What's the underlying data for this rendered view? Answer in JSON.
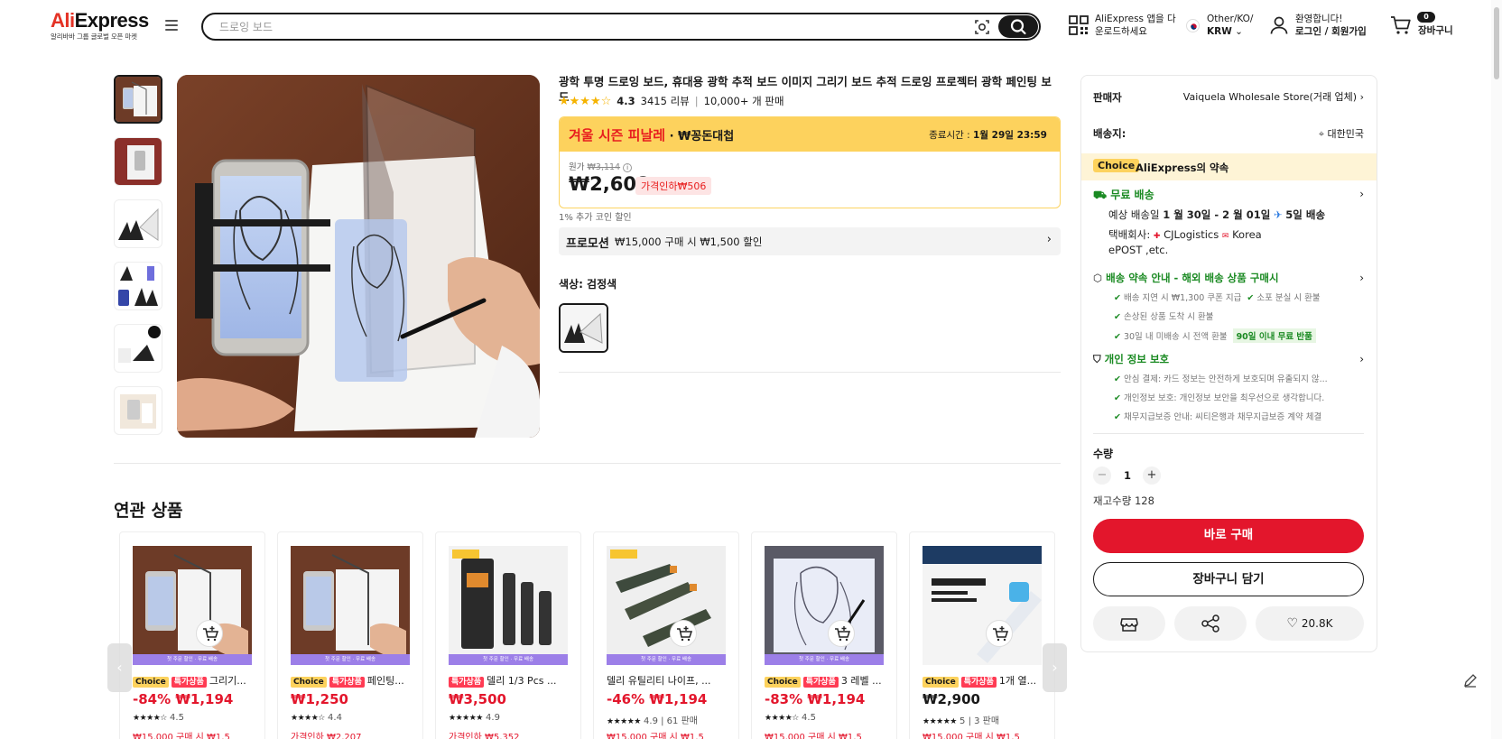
{
  "header": {
    "logo_brand": "AliExpress",
    "logo_sub": "알리바바 그룹 글로벌 오픈 마켓",
    "search_placeholder": "드로잉 보드",
    "app_line1": "AliExpress 앱을 다",
    "app_line2": "운로드하세요",
    "locale_line1": "Other/KO/",
    "locale_line2": "KRW",
    "account_line1": "환영합니다!",
    "account_line2": "로그인 / 회원가입",
    "cart_count": "0",
    "cart_label": "장바구니"
  },
  "product": {
    "title": "광학 투명 드로잉 보드, 휴대용 광학 추적 보드 이미지 그리기 보드 추적 드로잉 프로젝터 광학 페인팅 보드",
    "rating_stars": "★★★★☆",
    "rating_score": "4.3",
    "reviews": "3415 리뷰",
    "sold": "10,000+ 개 판매",
    "sale_name": "겨울 시즌 피날레",
    "sale_coupon": " · ₩꽁돈대첩",
    "end_label": "종료시간 :",
    "end_time": "1월 29일 23:59",
    "orig_label": "원가",
    "orig_price": "₩3,114",
    "price": "₩2,608",
    "discount_badge": "가격인하₩506",
    "coin_note": "1% 추가 코인 할인",
    "promo_label": "프로모션",
    "promo_text": "₩15,000 구매 시 ₩1,500 할인",
    "color_label": "색상: 검정색"
  },
  "panel": {
    "seller_label": "판매자",
    "seller_value": "Vaiquela Wholesale Store(거래 업체)",
    "ship_label": "배송지:",
    "ship_value": "대한민국",
    "choice_tag": "Choice",
    "choice_text": "AliExpress의 약속",
    "free_ship": "무료 배송",
    "eta_prefix": "예상 배송일",
    "eta_dates": "1 월 30일 - 2 월 01일",
    "eta_fast": "5일 배송",
    "carrier_prefix": "택배회사:",
    "carrier_1": "CJLogistics",
    "carrier_2": "Korea",
    "carrier_3": "ePOST ,etc.",
    "delivery_title": "배송 약속 안내 - 해외 배송 상품 구매시",
    "delivery_1": "배송 지연 시 ₩1,300 쿠폰 지급",
    "delivery_2": "소포 분실 시 환불",
    "delivery_3": "손상된 상품 도착 시 환불",
    "delivery_4": "30일 내 미배송 시 전액 환불",
    "delivery_4_tag": "90일 이내 무료 반품",
    "privacy_title": "개인 정보 보호",
    "privacy_1": "안심 결제: 카드 정보는 안전하게 보호되며 유출되지 않...",
    "privacy_2": "개인정보 보호: 개인정보 보안을 최우선으로 생각합니다.",
    "privacy_3": "채무지급보증 안내: 씨티은행과 채무지급보증 계약 체결",
    "qty_label": "수량",
    "qty_value": "1",
    "stock": "재고수량 128",
    "buy_now": "바로 구매",
    "add_cart": "장바구니 담기",
    "wishlist_count": "20.8K"
  },
  "related": {
    "title": "연관 상품",
    "strip_text": "첫 주문 할인 · 무료 배송",
    "items": [
      {
        "tag1": "Choice",
        "tag2": "특가상품",
        "name": "그리기...",
        "price": "-84% ₩1,194",
        "rating": "4.5",
        "extra": "₩15,000 구매 시 ₩1,5"
      },
      {
        "tag1": "Choice",
        "tag2": "특가상품",
        "name": "페인팅...",
        "price": "₩1,250",
        "rating": "4.4",
        "extra": "가격인하 ₩2,207"
      },
      {
        "tag1": "",
        "tag2": "특가상품",
        "name": "델리 1/3 Pcs ...",
        "price": "₩3,500",
        "rating": "4.9",
        "extra": "가격인하 ₩5,352"
      },
      {
        "tag1": "",
        "tag2": "",
        "name": "델리 유틸리티 나이프, ...",
        "price": "-46% ₩1,194",
        "rating": "4.9 | 61 판매",
        "extra": "₩15,000 구매 시 ₩1,5"
      },
      {
        "tag1": "Choice",
        "tag2": "특가상품",
        "name": "3 레벨 ...",
        "price": "-83% ₩1,194",
        "rating": "4.5",
        "extra": "₩15,000 구매 시 ₩1,5"
      },
      {
        "tag1": "Choice",
        "tag2": "특가상품",
        "name": "1개 열...",
        "price": "₩2,900",
        "rating": "5 | 3 판매",
        "extra": "₩15,000 구매 시 ₩1,5"
      }
    ]
  },
  "colors": {
    "accent_red": "#e3162c",
    "choice_yellow": "#fdd25d",
    "green": "#1a8a22"
  }
}
